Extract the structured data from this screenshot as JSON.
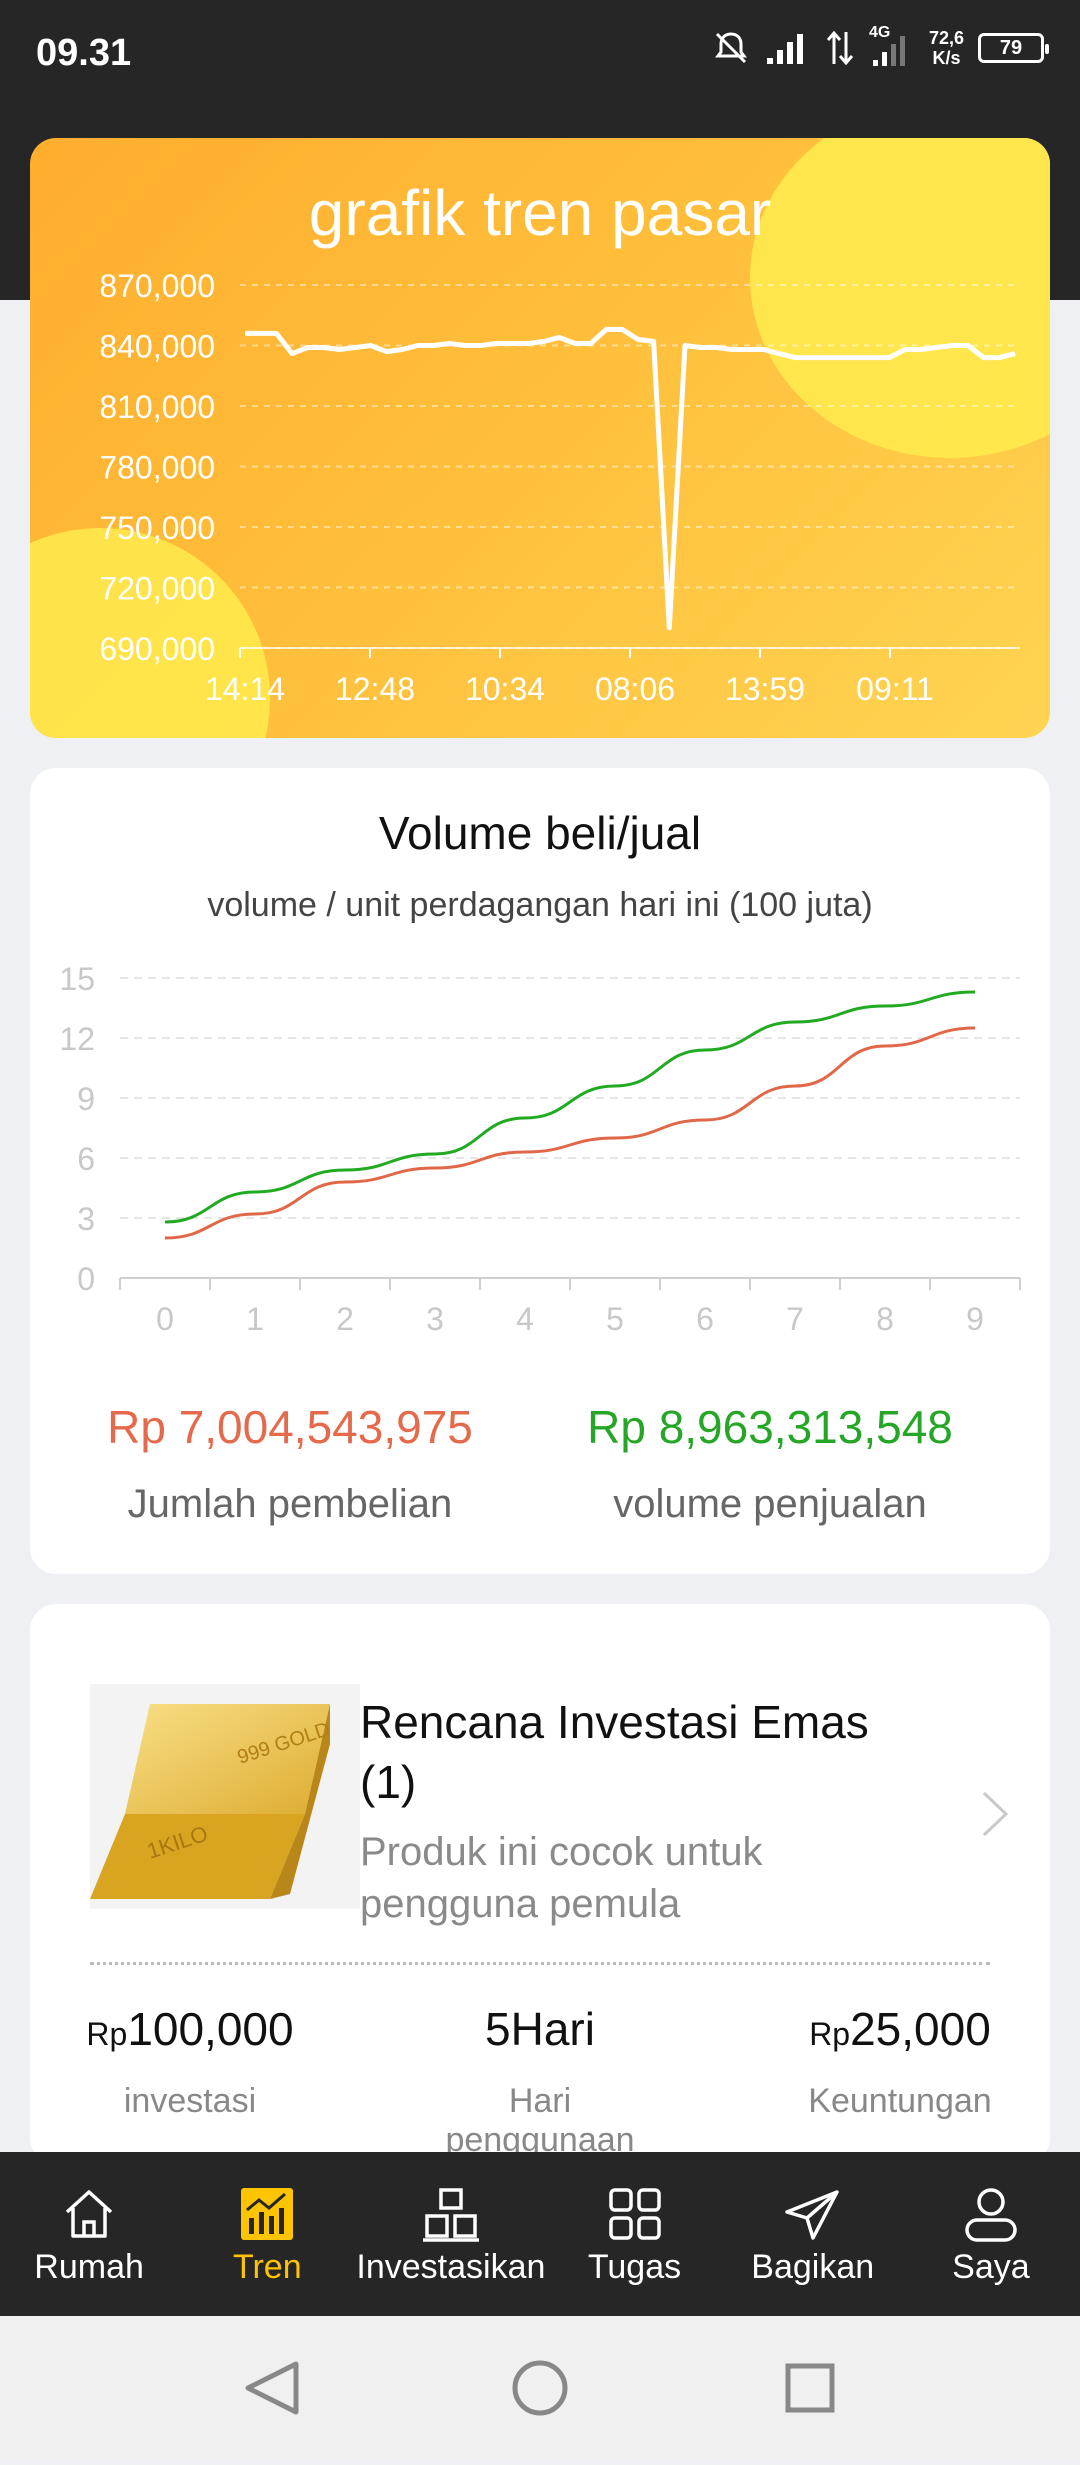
{
  "status_bar": {
    "time": "09.31",
    "net_speed_top": "72,6",
    "net_speed_bottom": "K/s",
    "network": "4G",
    "battery": "79"
  },
  "trend_card": {
    "title": "grafik tren pasar",
    "chart_data": {
      "type": "line",
      "y_ticks": [
        "870,000",
        "840,000",
        "810,000",
        "780,000",
        "750,000",
        "720,000",
        "690,000"
      ],
      "x_ticks": [
        "14:14",
        "12:48",
        "10:34",
        "08:06",
        "13:59",
        "09:11"
      ],
      "ylim": [
        690000,
        870000
      ],
      "series": [
        {
          "color": "#ffffff",
          "values": [
            846000,
            846000,
            846000,
            836000,
            839000,
            839000,
            838000,
            839000,
            840000,
            837000,
            838000,
            840000,
            840000,
            841000,
            840000,
            840000,
            841000,
            841000,
            841000,
            842000,
            844000,
            841000,
            841000,
            848000,
            848000,
            843000,
            842000,
            700000,
            840000,
            839000,
            839000,
            838000,
            838000,
            838000,
            836000,
            834000,
            834000,
            834000,
            834000,
            834000,
            834000,
            834000,
            838000,
            838000,
            839000,
            840000,
            840000,
            834000,
            834000,
            836000
          ]
        }
      ]
    }
  },
  "volume_card": {
    "title": "Volume beli/jual",
    "subtitle": "volume / unit perdagangan hari ini (100 juta)",
    "chart_data": {
      "type": "line",
      "categories": [
        "0",
        "1",
        "2",
        "3",
        "4",
        "5",
        "6",
        "7",
        "8",
        "9"
      ],
      "y_ticks": [
        "15",
        "12",
        "9",
        "6",
        "3",
        "0"
      ],
      "ylim": [
        0,
        15
      ],
      "series": [
        {
          "color": "#22aa22",
          "values": [
            2.8,
            4.3,
            5.4,
            6.2,
            8.0,
            9.6,
            11.4,
            12.8,
            13.6,
            14.3
          ]
        },
        {
          "color": "#e06848",
          "values": [
            2.0,
            3.2,
            4.8,
            5.5,
            6.3,
            7.0,
            7.9,
            9.6,
            11.6,
            12.5
          ]
        }
      ]
    },
    "purchase_value": "Rp 7,004,543,975",
    "purchase_label": "Jumlah pembelian",
    "purchase_color": "#e56a4c",
    "sales_value": "Rp 8,963,313,548",
    "sales_label": "volume penjualan",
    "sales_color": "#26a626"
  },
  "invest_card": {
    "product_title": "Rencana Investasi Emas (1)",
    "product_desc": "Produk ini cocok untuk pengguna pemula",
    "gold_bar_text_1": "999 GOLD",
    "gold_bar_text_2": "1KILO",
    "investment_currency": "Rp",
    "investment_amount": "100,000",
    "investment_label": "investasi",
    "days_value": "5Hari",
    "days_label": "Hari penggunaan",
    "profit_currency": "Rp",
    "profit_amount": "25,000",
    "profit_label": "Keuntungan"
  },
  "nav": {
    "items": [
      {
        "label": "Rumah",
        "icon": "home-icon"
      },
      {
        "label": "Tren",
        "icon": "chart-icon",
        "active": true
      },
      {
        "label": "Investasikan",
        "icon": "stack-icon"
      },
      {
        "label": "Tugas",
        "icon": "grid-icon"
      },
      {
        "label": "Bagikan",
        "icon": "send-icon"
      },
      {
        "label": "Saya",
        "icon": "user-icon"
      }
    ],
    "active_color": "#ffc400"
  }
}
